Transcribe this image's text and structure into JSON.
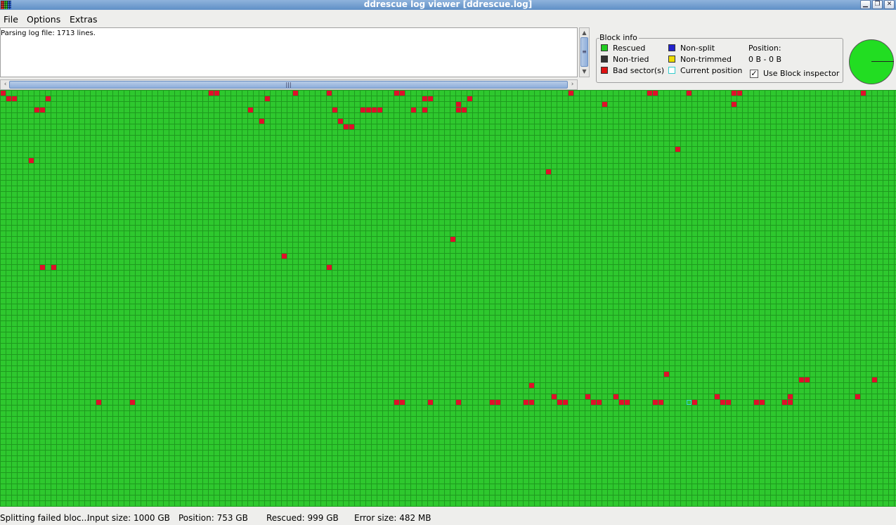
{
  "window": {
    "title": "ddrescue log viewer [ddrescue.log]"
  },
  "menu": [
    "File",
    "Options",
    "Extras"
  ],
  "log": {
    "text": "Parsing log file: 1713 lines."
  },
  "block_info": {
    "title": "Block info",
    "legend": [
      {
        "label": "Rescued",
        "color": "#22cc22"
      },
      {
        "label": "Non-tried",
        "color": "#333333"
      },
      {
        "label": "Bad sector(s)",
        "color": "#dd1111"
      },
      {
        "label": "Non-split",
        "color": "#2222cc"
      },
      {
        "label": "Non-trimmed",
        "color": "#eedd00"
      },
      {
        "label": "Current position",
        "color": "#ffffff",
        "border": "#33cccc"
      }
    ],
    "position_label": "Position:",
    "position_value": "0 B - 0 B",
    "use_block_inspector": "Use Block inspector",
    "use_block_inspector_checked": true
  },
  "grid": {
    "colors": {
      "rescued": "#2ec82e",
      "bad": "#e0102a",
      "line": "#1e9a1e"
    },
    "bad_blocks": [
      [
        0,
        0
      ],
      [
        37,
        0
      ],
      [
        38,
        0
      ],
      [
        52,
        0
      ],
      [
        58,
        0
      ],
      [
        70,
        0
      ],
      [
        71,
        0
      ],
      [
        101,
        0
      ],
      [
        115,
        0
      ],
      [
        116,
        0
      ],
      [
        122,
        0
      ],
      [
        130,
        0
      ],
      [
        131,
        0
      ],
      [
        153,
        0
      ],
      [
        1,
        1
      ],
      [
        2,
        1
      ],
      [
        8,
        1
      ],
      [
        47,
        1
      ],
      [
        75,
        1
      ],
      [
        76,
        1
      ],
      [
        83,
        1
      ],
      [
        81,
        2
      ],
      [
        107,
        2
      ],
      [
        130,
        2
      ],
      [
        6,
        3
      ],
      [
        7,
        3
      ],
      [
        44,
        3
      ],
      [
        59,
        3
      ],
      [
        64,
        3
      ],
      [
        65,
        3
      ],
      [
        66,
        3
      ],
      [
        67,
        3
      ],
      [
        73,
        3
      ],
      [
        75,
        3
      ],
      [
        81,
        3
      ],
      [
        82,
        3
      ],
      [
        46,
        5
      ],
      [
        60,
        5
      ],
      [
        61,
        6
      ],
      [
        62,
        6
      ],
      [
        120,
        10
      ],
      [
        5,
        12
      ],
      [
        97,
        14
      ],
      [
        80,
        26
      ],
      [
        50,
        29
      ],
      [
        7,
        31
      ],
      [
        9,
        31
      ],
      [
        58,
        31
      ],
      [
        118,
        50
      ],
      [
        142,
        51
      ],
      [
        143,
        51
      ],
      [
        155,
        51
      ],
      [
        94,
        52
      ],
      [
        98,
        54
      ],
      [
        104,
        54
      ],
      [
        109,
        54
      ],
      [
        127,
        54
      ],
      [
        140,
        54
      ],
      [
        152,
        54
      ],
      [
        17,
        55
      ],
      [
        23,
        55
      ],
      [
        70,
        55
      ],
      [
        71,
        55
      ],
      [
        76,
        55
      ],
      [
        81,
        55
      ],
      [
        87,
        55
      ],
      [
        88,
        55
      ],
      [
        93,
        55
      ],
      [
        94,
        55
      ],
      [
        99,
        55
      ],
      [
        100,
        55
      ],
      [
        105,
        55
      ],
      [
        106,
        55
      ],
      [
        110,
        55
      ],
      [
        111,
        55
      ],
      [
        116,
        55
      ],
      [
        117,
        55
      ],
      [
        123,
        55
      ],
      [
        128,
        55
      ],
      [
        129,
        55
      ],
      [
        134,
        55
      ],
      [
        135,
        55
      ],
      [
        139,
        55
      ],
      [
        140,
        55
      ]
    ],
    "current_block": [
      122,
      55
    ]
  },
  "status": {
    "message": "Splitting failed bloc...",
    "input_size": "Input size: 1000 GB",
    "position": "Position: 753 GB",
    "rescued": "Rescued: 999 GB",
    "error_size": "Error size: 482 MB"
  },
  "pie": {
    "rescued_fraction": 0.9995,
    "color": "#22dd22"
  }
}
